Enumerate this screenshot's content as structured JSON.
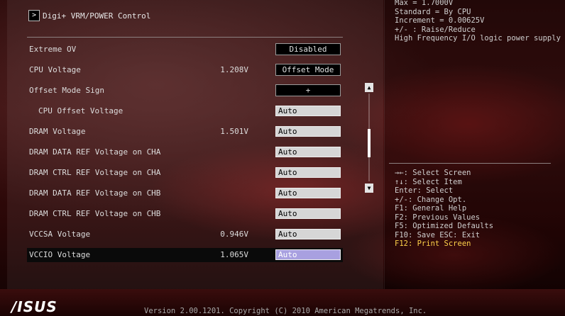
{
  "breadcrumb": {
    "arrow": ">",
    "label": "Digi+ VRM/POWER Control"
  },
  "settings": [
    {
      "label": "Extreme OV",
      "value": "",
      "control": "Disabled",
      "type": "button"
    },
    {
      "label": "CPU Voltage",
      "value": "1.208V",
      "control": "Offset Mode",
      "type": "button"
    },
    {
      "label": "Offset Mode Sign",
      "value": "",
      "control": "+",
      "type": "button"
    },
    {
      "label": "CPU Offset Voltage",
      "value": "",
      "control": "Auto",
      "type": "field"
    },
    {
      "label": "DRAM Voltage",
      "value": "1.501V",
      "control": "Auto",
      "type": "field"
    },
    {
      "label": "DRAM DATA REF Voltage on CHA",
      "value": "",
      "control": "Auto",
      "type": "field"
    },
    {
      "label": "DRAM CTRL REF Voltage on CHA",
      "value": "",
      "control": "Auto",
      "type": "field"
    },
    {
      "label": "DRAM DATA REF Voltage on CHB",
      "value": "",
      "control": "Auto",
      "type": "field"
    },
    {
      "label": "DRAM CTRL REF Voltage on CHB",
      "value": "",
      "control": "Auto",
      "type": "field"
    },
    {
      "label": "VCCSA Voltage",
      "value": "0.946V",
      "control": "Auto",
      "type": "field"
    },
    {
      "label": "VCCIO Voltage",
      "value": "1.065V",
      "control": "Auto",
      "type": "field",
      "selected": true
    }
  ],
  "scrollbar": {
    "up_glyph": "▲",
    "down_glyph": "▼"
  },
  "help_text": [
    "Max = 1.7000V",
    "Standard = By CPU",
    "Increment = 0.00625V",
    "+/- : Raise/Reduce",
    "High Frequency I/O logic power supply"
  ],
  "key_help": [
    "→←: Select Screen",
    "↑↓: Select Item",
    "Enter: Select",
    "+/-: Change Opt.",
    "F1: General Help",
    "F2: Previous Values",
    "F5: Optimized Defaults",
    "F10: Save  ESC: Exit",
    "F12: Print Screen"
  ],
  "footer": {
    "logo": "/ISUS",
    "version": "Version 2.00.1201. Copyright (C) 2010 American Megatrends, Inc."
  }
}
